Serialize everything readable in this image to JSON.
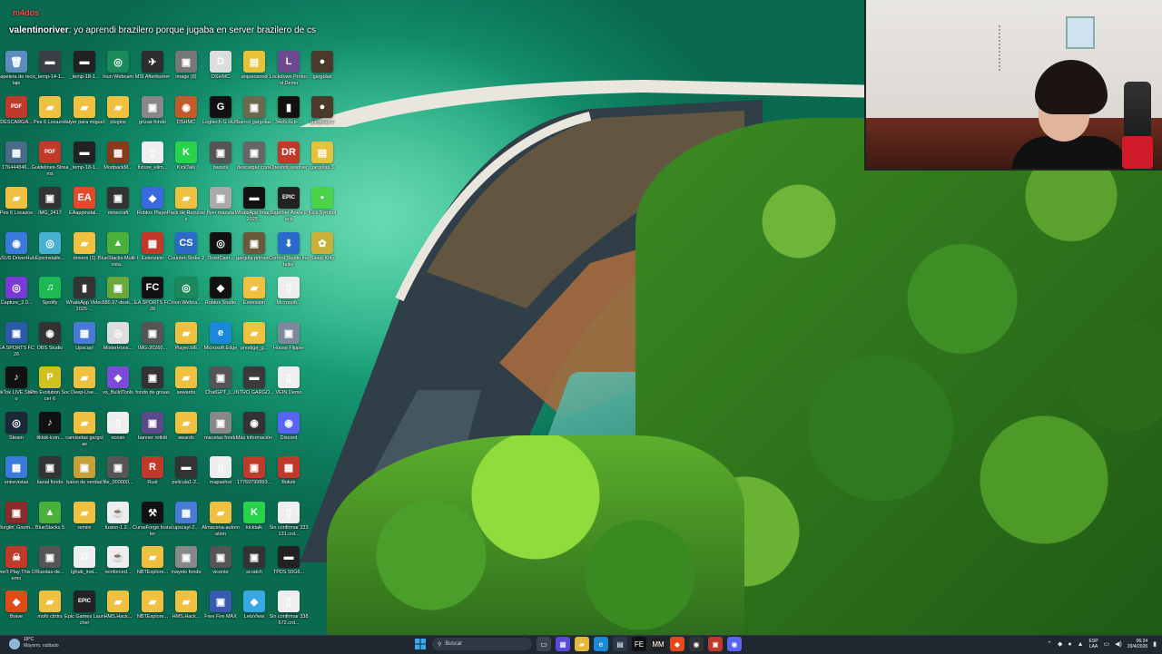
{
  "chat": {
    "streamer_tag": "m4dos",
    "user": "valentinoriver",
    "message": ": yo aprendi brazilero porque jugaba en server brazilero de cs"
  },
  "desktop_icons": [
    {
      "label": "Papelera de reciclaje",
      "color": "#5b8dbf",
      "glyph": "🗑"
    },
    {
      "label": "_temp-14-1...",
      "color": "#3a3f46",
      "glyph": "▬"
    },
    {
      "label": "_temp-18-1...",
      "color": "#222",
      "glyph": "▬"
    },
    {
      "label": "Iriun Webcam",
      "color": "#1a8a5a",
      "glyph": "◎"
    },
    {
      "label": "MSI Afterburner",
      "color": "#2d2d2d",
      "glyph": "✈"
    },
    {
      "label": "image (8)",
      "color": "#777",
      "glyph": "▣"
    },
    {
      "label": "DSHMC",
      "color": "#ddd",
      "glyph": "D"
    },
    {
      "label": "arqueosnod",
      "color": "#e6c13a",
      "glyph": "▤"
    },
    {
      "label": "Lockdown Protocol Demo",
      "color": "#6b4a8f",
      "glyph": "L"
    },
    {
      "label": "gargolas",
      "color": "#4a3a2a",
      "glyph": "●"
    },
    {
      "label": "DESCARGA...",
      "color": "#c0392b",
      "glyph": "PDF"
    },
    {
      "label": "Pes 6 Locazos",
      "color": "#f0c040",
      "glyph": "▰"
    },
    {
      "label": "falyer para miguel",
      "color": "#f0c040",
      "glyph": "▰"
    },
    {
      "label": "plugins",
      "color": "#f0c040",
      "glyph": "▰"
    },
    {
      "label": "grizas fondo",
      "color": "#888",
      "glyph": "▣"
    },
    {
      "label": "DSHMC",
      "color": "#c45a2a",
      "glyph": "◉"
    },
    {
      "label": "Logitech G HUB",
      "color": "#111",
      "glyph": "G"
    },
    {
      "label": "banco gargolas",
      "color": "#6a6a50",
      "glyph": "▣"
    },
    {
      "label": "34e6c6cb-...",
      "color": "#111",
      "glyph": "▮"
    },
    {
      "label": "gargolas 2",
      "color": "#4a3a2a",
      "glyph": "●"
    },
    {
      "label": "176444846...",
      "color": "#4a6a8a",
      "glyph": "▦"
    },
    {
      "label": "Guidelines-Streams",
      "color": "#c0392b",
      "glyph": "PDF"
    },
    {
      "label": "_temp-18-1...",
      "color": "#222",
      "glyph": "▬"
    },
    {
      "label": "ModpackM...",
      "color": "#8a3a1a",
      "glyph": "▦"
    },
    {
      "label": "fixture_elim...",
      "color": "#eee",
      "glyph": "▯"
    },
    {
      "label": "KickTalk",
      "color": "#27d34a",
      "glyph": "K"
    },
    {
      "label": "basura",
      "color": "#555",
      "glyph": "▣"
    },
    {
      "label": "descargar code",
      "color": "#666",
      "glyph": "▣"
    },
    {
      "label": "Oneshot resolver",
      "color": "#c0392b",
      "glyph": "DR"
    },
    {
      "label": "gargolas 3",
      "color": "#e6c13a",
      "glyph": "▤"
    },
    {
      "label": "Pes 6 Locazos",
      "color": "#f0c040",
      "glyph": "▰"
    },
    {
      "label": "IMG_2417",
      "color": "#333",
      "glyph": "▣"
    },
    {
      "label": "EAappinstal...",
      "color": "#e34a2a",
      "glyph": "EA"
    },
    {
      "label": "minecraft",
      "color": "#333",
      "glyph": "▣"
    },
    {
      "label": "Roblox Player",
      "color": "#3a6ae0",
      "glyph": "◆"
    },
    {
      "label": "Pack de Recursos",
      "color": "#f0c040",
      "glyph": "▰"
    },
    {
      "label": "flyer maceta",
      "color": "#aaa",
      "glyph": "▣"
    },
    {
      "label": "WhatsApp Image 2025...",
      "color": "#111",
      "glyph": "▬"
    },
    {
      "label": "Together Ankle Pack",
      "color": "#222",
      "glyph": "EPIC"
    },
    {
      "label": "Kick Symbol",
      "color": "#4bd34a",
      "glyph": "▪"
    },
    {
      "label": "ASUS DriverHub",
      "color": "#3a7ad8",
      "glyph": "◉"
    },
    {
      "label": "Epicinstalle...",
      "color": "#49b0d0",
      "glyph": "◎"
    },
    {
      "label": "drivers (1)",
      "color": "#f0c040",
      "glyph": "▰"
    },
    {
      "label": "BlueStacks Multi-Insta...",
      "color": "#4ab03a",
      "glyph": "▲"
    },
    {
      "label": "Extension",
      "color": "#c0392b",
      "glyph": "▦"
    },
    {
      "label": "Counter-Strike 2",
      "color": "#2a6ac8",
      "glyph": "CS"
    },
    {
      "label": "DroidCam...",
      "color": "#111",
      "glyph": "◎"
    },
    {
      "label": "gargola primer...",
      "color": "#6a5a3a",
      "glyph": "▣"
    },
    {
      "label": "Control Studio Installer",
      "color": "#2a6ac8",
      "glyph": "⬇"
    },
    {
      "label": "Sleep Kitty",
      "color": "#c8b03a",
      "glyph": "✿"
    },
    {
      "label": "Capture_2.0...",
      "color": "#7a3ad8",
      "glyph": "◎"
    },
    {
      "label": "Spotify",
      "color": "#1db954",
      "glyph": "♫"
    },
    {
      "label": "WhatsApp Video 2025-...",
      "color": "#333",
      "glyph": "▮"
    },
    {
      "label": "580.97-desk...",
      "color": "#6aa83a",
      "glyph": "▣"
    },
    {
      "label": "EA SPORTS FC 26",
      "color": "#111",
      "glyph": "FC"
    },
    {
      "label": "Iriun Webca...",
      "color": "#1a8a5a",
      "glyph": "◎"
    },
    {
      "label": "Roblox Studio",
      "color": "#111",
      "glyph": "◆"
    },
    {
      "label": "Extension",
      "color": "#f0c040",
      "glyph": "▰"
    },
    {
      "label": "Microsoft...",
      "color": "#eee",
      "glyph": "▯"
    },
    {
      "label": "EA SPORTS FC 26",
      "color": "#2a5aa8",
      "glyph": "▣"
    },
    {
      "label": "OBS Studio",
      "color": "#333",
      "glyph": "◉"
    },
    {
      "label": "Upscayl",
      "color": "#4a7ad8",
      "glyph": "▦"
    },
    {
      "label": "MisterHons...",
      "color": "#ddd",
      "glyph": "◎"
    },
    {
      "label": "IMG-20260...",
      "color": "#555",
      "glyph": "▣"
    },
    {
      "label": "Player.ME",
      "color": "#f0c040",
      "glyph": "▰"
    },
    {
      "label": "Microsoft Edge",
      "color": "#1a8ad8",
      "glyph": "e"
    },
    {
      "label": "prestige_g...",
      "color": "#f0c040",
      "glyph": "▰"
    },
    {
      "label": "House Flipper",
      "color": "#7a8a9a",
      "glyph": "▣"
    },
    {
      "label": "TikTok LIVE Studio",
      "color": "#111",
      "glyph": "♪"
    },
    {
      "label": "Pro Evolution Soccer 6",
      "color": "#d0c020",
      "glyph": "P"
    },
    {
      "label": "Deep-Live...",
      "color": "#f0c040",
      "glyph": "▰"
    },
    {
      "label": "vs_BuildTools",
      "color": "#7a4ad8",
      "glyph": "◆"
    },
    {
      "label": "fondo de grisas",
      "color": "#333",
      "glyph": "▣"
    },
    {
      "label": "sewards",
      "color": "#f0c040",
      "glyph": "▰"
    },
    {
      "label": "ChatGPT_L...",
      "color": "#555",
      "glyph": "▣"
    },
    {
      "label": "INTRO GARGO...",
      "color": "#3a3a3a",
      "glyph": "▬"
    },
    {
      "label": "VEIN Demo",
      "color": "#eee",
      "glyph": "▯"
    },
    {
      "label": "Steam",
      "color": "#1b2838",
      "glyph": "◎"
    },
    {
      "label": "tiktok-icon...",
      "color": "#111",
      "glyph": "♪"
    },
    {
      "label": "camisetas gargolas",
      "color": "#f0c040",
      "glyph": "▰"
    },
    {
      "label": "ocean",
      "color": "#eee",
      "glyph": "▯"
    },
    {
      "label": "banner rotkitt",
      "color": "#5a4a8a",
      "glyph": "▣"
    },
    {
      "label": "awards",
      "color": "#f0c040",
      "glyph": "▰"
    },
    {
      "label": "macetas fondo",
      "color": "#888",
      "glyph": "▣"
    },
    {
      "label": "Más información",
      "color": "#333",
      "glyph": "◉"
    },
    {
      "label": "Discord",
      "color": "#5865f2",
      "glyph": "◉"
    },
    {
      "label": "entrevistas",
      "color": "#3a7ad8",
      "glyph": "▦"
    },
    {
      "label": "banal fondo",
      "color": "#333",
      "glyph": "▣"
    },
    {
      "label": "balon de verdad",
      "color": "#c8a03a",
      "glyph": "▣"
    },
    {
      "label": "file_000000...",
      "color": "#555",
      "glyph": "▣"
    },
    {
      "label": "Rust",
      "color": "#c0392b",
      "glyph": "R"
    },
    {
      "label": "pelicula1-2...",
      "color": "#333",
      "glyph": "▬"
    },
    {
      "label": "mapashot",
      "color": "#eee",
      "glyph": "▯"
    },
    {
      "label": "17769799893...",
      "color": "#c03a2a",
      "glyph": "▣"
    },
    {
      "label": "Bokstr",
      "color": "#c0392b",
      "glyph": "▦"
    },
    {
      "label": "Burglin' Gnom...",
      "color": "#8a2a2a",
      "glyph": "▣"
    },
    {
      "label": "BlueStacks 5",
      "color": "#4ab03a",
      "glyph": "▲"
    },
    {
      "label": "remini",
      "color": "#f0c040",
      "glyph": "▰"
    },
    {
      "label": "fusion-1.2...",
      "color": "#eee",
      "glyph": "☕"
    },
    {
      "label": "CurseForge Installer",
      "color": "#111",
      "glyph": "⚒"
    },
    {
      "label": "upscayl-2...",
      "color": "#4a7ad8",
      "glyph": "▦"
    },
    {
      "label": "Almacena-automation",
      "color": "#f0c040",
      "glyph": "▰"
    },
    {
      "label": "kicktalk",
      "color": "#27d34a",
      "glyph": "K"
    },
    {
      "label": "Sin confirmar 333131.crd...",
      "color": "#eee",
      "glyph": "▯"
    },
    {
      "label": "Don't Play This Demo",
      "color": "#c0392b",
      "glyph": "☠"
    },
    {
      "label": "Ruedas-de...",
      "color": "#555",
      "glyph": "▣"
    },
    {
      "label": "lghub_inst...",
      "color": "#eee",
      "glyph": "G"
    },
    {
      "label": "reinforced...",
      "color": "#eee",
      "glyph": "☕"
    },
    {
      "label": "NBTExplore...",
      "color": "#f0c040",
      "glyph": "▰"
    },
    {
      "label": "mayelo fondo",
      "color": "#888",
      "glyph": "▣"
    },
    {
      "label": "vicente",
      "color": "#555",
      "glyph": "▣"
    },
    {
      "label": "scratch",
      "color": "#333",
      "glyph": "▣"
    },
    {
      "label": "TPDS 50G6...",
      "color": "#222",
      "glyph": "▬"
    },
    {
      "label": "Brave",
      "color": "#e24a1a",
      "glyph": "◆"
    },
    {
      "label": "mofo citrtrs",
      "color": "#f0c040",
      "glyph": "▰"
    },
    {
      "label": "Epic Games Launcher",
      "color": "#222",
      "glyph": "EPIC"
    },
    {
      "label": "HMS.Hack...",
      "color": "#f0c040",
      "glyph": "▰"
    },
    {
      "label": "NBTExplore...",
      "color": "#f0c040",
      "glyph": "▰"
    },
    {
      "label": "HMS.Hack...",
      "color": "#f0c040",
      "glyph": "▰"
    },
    {
      "label": "Free Fire MAX",
      "color": "#3a5ab0",
      "glyph": "▣"
    },
    {
      "label": "LetsView",
      "color": "#3aa8e0",
      "glyph": "◆"
    },
    {
      "label": "Sin confirmar 338672.crd...",
      "color": "#eee",
      "glyph": "▯"
    }
  ],
  "taskbar": {
    "weather_temp": "19°C",
    "weather_cond": "Mayorm. nublado",
    "search_placeholder": "Buscar",
    "lang_line1": "ESP",
    "lang_line2": "LAA",
    "time": "06:24",
    "date": "20/4/2026"
  },
  "colors": {
    "taskbar_bg": "#1f2730",
    "accent": "#2a7ad8"
  }
}
